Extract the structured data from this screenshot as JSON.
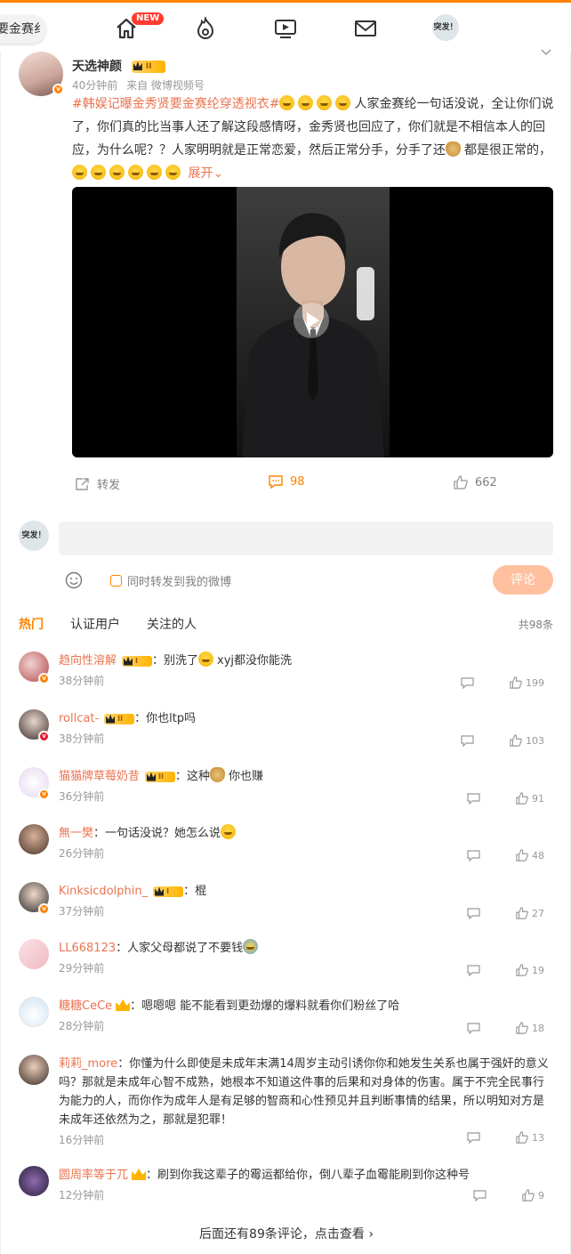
{
  "topnav": {
    "search_text": "要金赛纟",
    "new_badge": "NEW",
    "avatar_text": "突发！"
  },
  "post": {
    "author": "天选神颜",
    "level": "II",
    "time": "40分钟前",
    "source": "来自 微博视频号",
    "topic": "#韩娱记曝金秀贤要金赛纶穿透视衣#",
    "text_main": "人家金赛纶一句话没说，全让你们说了，你们真的比当事人还了解这段感情呀，金秀贤也回应了，你们就是不相信本人的回应，为什么呢？？人家明明就是正常恋爱，然后正常分手，分手了还",
    "text_tail": "都是很正常的，",
    "expand": "展开",
    "repost_label": "转发",
    "comment_count": "98",
    "like_count": "662"
  },
  "composer": {
    "placeholder": "",
    "repost_option": "同时转发到我的微博",
    "submit_label": "评论",
    "avatar_text": "突发！"
  },
  "tabs": {
    "hot": "热门",
    "verified": "认证用户",
    "following": "关注的人",
    "total": "共98条"
  },
  "comments": [
    {
      "name": "趋向性溶解",
      "level": "I",
      "sep": "：",
      "text_before": "别洗了",
      "text_after": "xyj都没你能洗",
      "time": "38分钟前",
      "likes": "199"
    },
    {
      "name": "rollcat-",
      "level": "II",
      "sep": "：",
      "text_before": "你也ltp吗",
      "text_after": "",
      "time": "38分钟前",
      "likes": "103"
    },
    {
      "name": "猫猫牌草莓奶昔",
      "level": "II",
      "sep": "：",
      "text_before": "这种",
      "text_after": "你也赚",
      "time": "36分钟前",
      "likes": "91"
    },
    {
      "name": "無一樊",
      "level": "",
      "sep": "：",
      "text_before": "一句话没说？她怎么说",
      "text_after": "",
      "time": "26分钟前",
      "likes": "48"
    },
    {
      "name": "Kinksicdolphin_",
      "level": "I",
      "sep": "：",
      "text_before": "棍",
      "text_after": "",
      "time": "37分钟前",
      "likes": "27"
    },
    {
      "name": "LL668123",
      "level": "",
      "sep": "：",
      "text_before": "人家父母都说了不要钱",
      "text_after": "",
      "time": "29分钟前",
      "likes": "19"
    },
    {
      "name": "糖糖CeCe",
      "level": "",
      "sep": "：",
      "text_before": "嗯嗯嗯 能不能看到更劲爆的爆料就看你们粉丝了哈",
      "text_after": "",
      "time": "28分钟前",
      "likes": "18"
    },
    {
      "name": "莉莉_more",
      "level": "",
      "sep": "：",
      "text_before": "你懂为什么即使是未成年末满14周岁主动引诱你你和她发生关系也属于强奸的意义吗？那就是未成年心智不成熟，她根本不知道这件事的后果和对身体的伤害。属于不完全民事行为能力的人，而你作为成年人是有足够的智商和心性预见并且判断事情的结果，所以明知对方是未成年还依然为之，那就是犯罪！",
      "text_after": "",
      "time": "16分钟前",
      "likes": "13"
    },
    {
      "name": "圆周率等于兀",
      "level": "",
      "sep": "：",
      "text_before": "刷到你我这辈子的霉运都给你，倒八辈子血霉能刷到你这种号",
      "text_after": "",
      "time": "12分钟前",
      "likes": "9"
    }
  ],
  "more_comments": "后面还有89条评论，点击查看",
  "colors": {
    "accent": "#ff8200",
    "link": "#eb7350",
    "meta": "#999999"
  }
}
